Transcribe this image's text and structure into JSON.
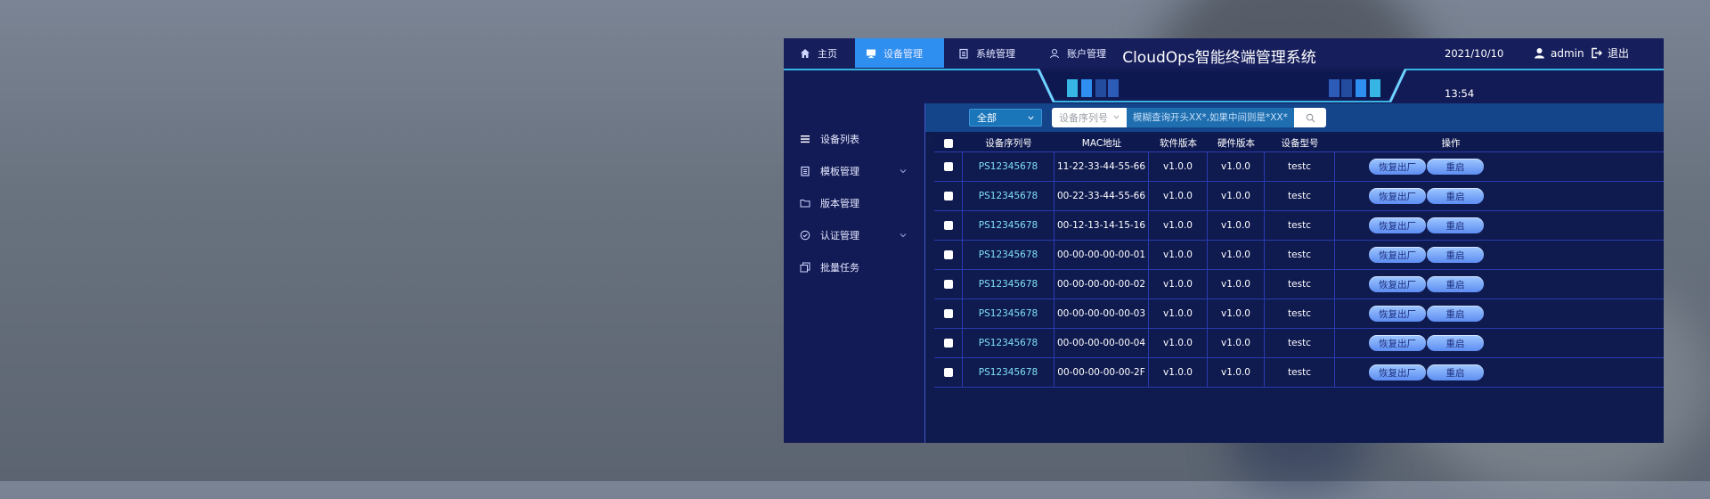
{
  "header": {
    "nav": [
      {
        "label": "主页",
        "icon": "home-icon"
      },
      {
        "label": "设备管理",
        "icon": "monitor-icon"
      },
      {
        "label": "系统管理",
        "icon": "clipboard-icon"
      },
      {
        "label": "账户管理",
        "icon": "user-icon"
      }
    ],
    "active_nav": "设备管理",
    "date": "2021/10/10",
    "time": "13:54",
    "username": "admin",
    "logout_label": "退出",
    "title": "CloudOps智能终端管理系统"
  },
  "sidebar": {
    "items": [
      {
        "label": "设备列表",
        "icon": "list-icon",
        "has_submenu": false
      },
      {
        "label": "模板管理",
        "icon": "clipboard-icon",
        "has_submenu": true
      },
      {
        "label": "版本管理",
        "icon": "folder-icon",
        "has_submenu": false
      },
      {
        "label": "认证管理",
        "icon": "check-circle-icon",
        "has_submenu": true
      },
      {
        "label": "批量任务",
        "icon": "copy-icon",
        "has_submenu": false
      }
    ]
  },
  "toolbar": {
    "filter_value": "全部",
    "field_select": "设备序列号",
    "search_placeholder": "模糊查询开头XX*,如果中间则是*XX*"
  },
  "table": {
    "columns": [
      "设备序列号",
      "MAC地址",
      "软件版本",
      "硬件版本",
      "设备型号",
      "操作"
    ],
    "action_restore": "恢复出厂",
    "action_reboot": "重启",
    "rows": [
      {
        "serial": "PS12345678",
        "mac": "11-22-33-44-55-66",
        "sw": "v1.0.0",
        "hw": "v1.0.0",
        "model": "testc"
      },
      {
        "serial": "PS12345678",
        "mac": "00-22-33-44-55-66",
        "sw": "v1.0.0",
        "hw": "v1.0.0",
        "model": "testc"
      },
      {
        "serial": "PS12345678",
        "mac": "00-12-13-14-15-16",
        "sw": "v1.0.0",
        "hw": "v1.0.0",
        "model": "testc"
      },
      {
        "serial": "PS12345678",
        "mac": "00-00-00-00-00-01",
        "sw": "v1.0.0",
        "hw": "v1.0.0",
        "model": "testc"
      },
      {
        "serial": "PS12345678",
        "mac": "00-00-00-00-00-02",
        "sw": "v1.0.0",
        "hw": "v1.0.0",
        "model": "testc"
      },
      {
        "serial": "PS12345678",
        "mac": "00-00-00-00-00-03",
        "sw": "v1.0.0",
        "hw": "v1.0.0",
        "model": "testc"
      },
      {
        "serial": "PS12345678",
        "mac": "00-00-00-00-00-04",
        "sw": "v1.0.0",
        "hw": "v1.0.0",
        "model": "testc"
      },
      {
        "serial": "PS12345678",
        "mac": "00-00-00-00-00-2F",
        "sw": "v1.0.0",
        "hw": "v1.0.0",
        "model": "testc"
      }
    ]
  },
  "colors": {
    "app_bg": "#131b56",
    "active_nav": "#2f8ff0",
    "serial_text": "#7fe0f2",
    "banner_accent": "#37b6e6",
    "button_pill": "#7ea9f7"
  }
}
